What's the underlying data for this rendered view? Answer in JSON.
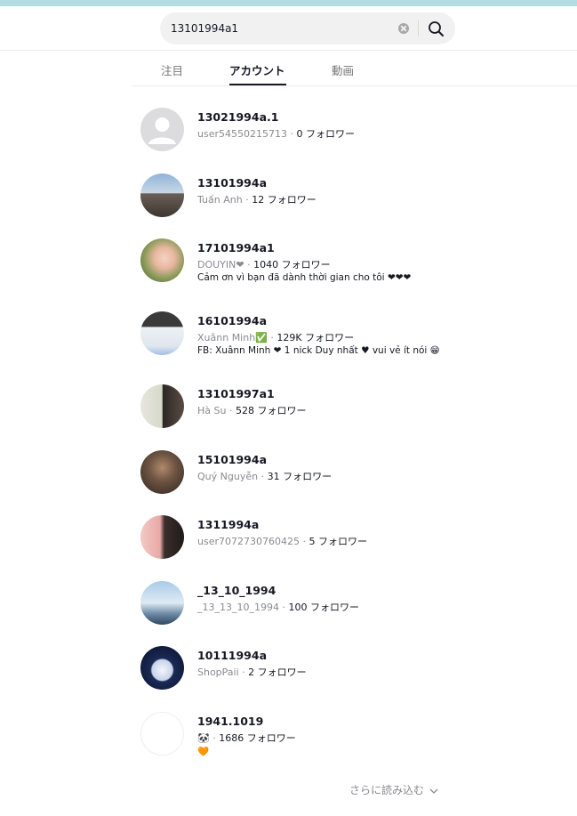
{
  "search": {
    "query": "13101994a1"
  },
  "tabs": [
    {
      "label": "注目"
    },
    {
      "label": "アカウント"
    },
    {
      "label": "動画"
    }
  ],
  "accounts": [
    {
      "username": "13021994a.1",
      "nickname": "user54550215713",
      "followers": "0 フォロワー",
      "bio": ""
    },
    {
      "username": "13101994a",
      "nickname": "Tuấn Anh",
      "followers": "12 フォロワー",
      "bio": ""
    },
    {
      "username": "17101994a1",
      "nickname": "DOUYIN❤",
      "followers": "1040 フォロワー",
      "bio": "Cảm ơn vì bạn đã dành thời gian cho tôi ❤❤❤"
    },
    {
      "username": "16101994a",
      "nickname": "Xuânn Minh✅",
      "followers": "129K フォロワー",
      "bio": "FB: Xuânn Minh ❤ 1 nick Duy nhất ♥ vui vẻ ít nói 😁"
    },
    {
      "username": "13101997a1",
      "nickname": "Hà Su",
      "followers": "528 フォロワー",
      "bio": ""
    },
    {
      "username": "15101994a",
      "nickname": "Quý Nguyễn",
      "followers": "31 フォロワー",
      "bio": ""
    },
    {
      "username": "1311994a",
      "nickname": "user7072730760425",
      "followers": "5 フォロワー",
      "bio": ""
    },
    {
      "username": "_13_10_1994",
      "nickname": "_13_13_10_1994",
      "followers": "100 フォロワー",
      "bio": ""
    },
    {
      "username": "10111994a",
      "nickname": "ShopPaii",
      "followers": "2 フォロワー",
      "bio": ""
    },
    {
      "username": "1941.1019",
      "nickname": "🐼",
      "followers": "1686 フォロワー",
      "bio": "🧡"
    }
  ],
  "load_more": "さらに読み込む"
}
